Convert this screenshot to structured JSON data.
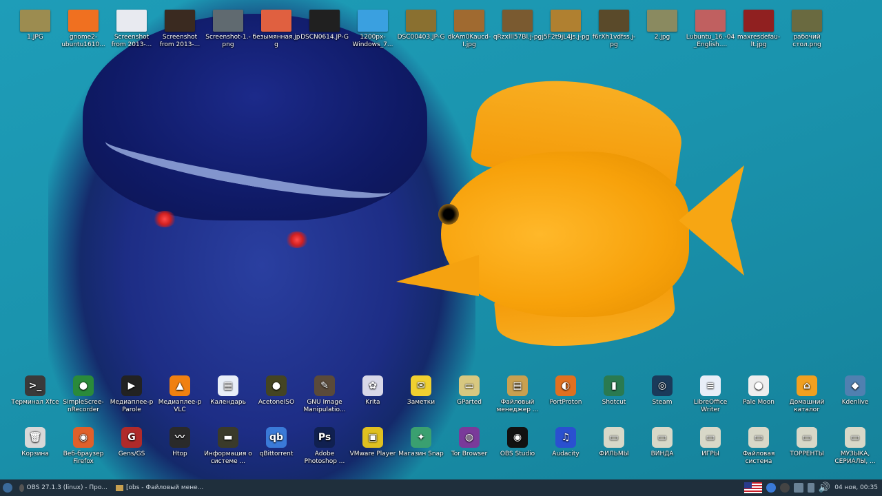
{
  "top_icons": [
    {
      "label": "1.JPG",
      "color": "#9c8c50"
    },
    {
      "label": "gnome2-ubuntu1610...",
      "color": "#f07020"
    },
    {
      "label": "Screenshot from 2013-...",
      "color": "#e8eaf0"
    },
    {
      "label": "Screenshot from 2013-...",
      "color": "#3a2a20"
    },
    {
      "label": "Screenshot-1.-png",
      "color": "#606a70"
    },
    {
      "label": "безымянная.jpg",
      "color": "#e06040"
    },
    {
      "label": "DSCN0614.JP-G",
      "color": "#202020"
    },
    {
      "label": "1200px-Windows_7...",
      "color": "#3aa0e0"
    },
    {
      "label": "DSC00403.JP-G",
      "color": "#8a7030"
    },
    {
      "label": "dkAm0Kaucd-I.jpg",
      "color": "#a06a30"
    },
    {
      "label": "qRzxIII57BI.j-pg",
      "color": "#7a5a30"
    },
    {
      "label": "j5F2t9jL4Js.j-pg",
      "color": "#b08030"
    },
    {
      "label": "f6rXh1vdfss.j-pg",
      "color": "#5a4a2a"
    },
    {
      "label": "2.jpg",
      "color": "#8a8a60"
    },
    {
      "label": "Lubuntu_16.-04_English....",
      "color": "#c06060"
    },
    {
      "label": "maxresdefau-lt.jpg",
      "color": "#902020"
    },
    {
      "label": "рабочий стол.png",
      "color": "#6a6a40"
    }
  ],
  "row1_icons": [
    {
      "label": "Терминал Xfce",
      "icon": "terminal-icon",
      "glyph": ">_",
      "color": "#3a3a3a"
    },
    {
      "label": "SimpleScree-nRecorder",
      "icon": "simplescreenrecorder-icon",
      "glyph": "●",
      "color": "#2a8a3a"
    },
    {
      "label": "Медиаплее-р Parole",
      "icon": "parole-icon",
      "glyph": "▶",
      "color": "#222"
    },
    {
      "label": "Медиаплее-р VLC",
      "icon": "vlc-icon",
      "glyph": "▲",
      "color": "#f08010"
    },
    {
      "label": "Календарь",
      "icon": "calendar-icon",
      "glyph": "▦",
      "color": "#e8eef8"
    },
    {
      "label": "AcetoneISO",
      "icon": "acetoneiso-icon",
      "glyph": "●",
      "color": "#442"
    },
    {
      "label": "GNU Image Manipulatio...",
      "icon": "gimp-icon",
      "glyph": "✎",
      "color": "#5a4a3a"
    },
    {
      "label": "Krita",
      "icon": "krita-icon",
      "glyph": "✿",
      "color": "#d8d8e8"
    },
    {
      "label": "Заметки",
      "icon": "notes-icon",
      "glyph": "✉",
      "color": "#f0d030"
    },
    {
      "label": "GParted",
      "icon": "gparted-icon",
      "glyph": "▭",
      "color": "#d8c880"
    },
    {
      "label": "Файловый менеджер ...",
      "icon": "file-manager-icon",
      "glyph": "▤",
      "color": "#c8a050"
    },
    {
      "label": "PortProton",
      "icon": "portproton-icon",
      "glyph": "◐",
      "color": "#e07020"
    },
    {
      "label": "Shotcut",
      "icon": "shotcut-icon",
      "glyph": "▮",
      "color": "#2a7a50"
    },
    {
      "label": "Steam",
      "icon": "steam-icon",
      "glyph": "◎",
      "color": "#1a3a5a"
    },
    {
      "label": "LibreOffice Writer",
      "icon": "libreoffice-writer-icon",
      "glyph": "≡",
      "color": "#e8eef8"
    },
    {
      "label": "Pale Moon",
      "icon": "palemoon-icon",
      "glyph": "●",
      "color": "#eeeeee"
    },
    {
      "label": "Домашний каталог",
      "icon": "home-folder-icon",
      "glyph": "⌂",
      "color": "#f0a020"
    },
    {
      "label": "Kdenlive",
      "icon": "kdenlive-icon",
      "glyph": "◆",
      "color": "#5080b0"
    }
  ],
  "row2_icons": [
    {
      "label": "Корзина",
      "icon": "trash-icon",
      "glyph": "🗑",
      "color": "#d8d8d8"
    },
    {
      "label": "Веб-браузер Firefox",
      "icon": "firefox-icon",
      "glyph": "◉",
      "color": "#e0602a"
    },
    {
      "label": "Gens/GS",
      "icon": "gens-icon",
      "glyph": "G",
      "color": "#b02a2a"
    },
    {
      "label": "Htop",
      "icon": "htop-icon",
      "glyph": "〰",
      "color": "#2a2a2a"
    },
    {
      "label": "Информация о системе ...",
      "icon": "system-info-icon",
      "glyph": "▬",
      "color": "#3a3a2a"
    },
    {
      "label": "qBittorrent",
      "icon": "qbittorrent-icon",
      "glyph": "qb",
      "color": "#3a7ad8"
    },
    {
      "label": "Adobe Photoshop ...",
      "icon": "photoshop-icon",
      "glyph": "Ps",
      "color": "#102050"
    },
    {
      "label": "VMware Player",
      "icon": "vmware-icon",
      "glyph": "▣",
      "color": "#e0c020"
    },
    {
      "label": "Магазин Snap",
      "icon": "snap-store-icon",
      "glyph": "✦",
      "color": "#3aa070"
    },
    {
      "label": "Tor Browser",
      "icon": "tor-icon",
      "glyph": "◍",
      "color": "#7a3a9a"
    },
    {
      "label": "OBS Studio",
      "icon": "obs-icon",
      "glyph": "◉",
      "color": "#111"
    },
    {
      "label": "Audacity",
      "icon": "audacity-icon",
      "glyph": "♫",
      "color": "#2a50d0"
    },
    {
      "label": "ФИЛЬМЫ",
      "icon": "drive-icon",
      "glyph": "▭",
      "color": "#d8d8c8"
    },
    {
      "label": "ВИНДА",
      "icon": "drive-icon",
      "glyph": "▭",
      "color": "#d8d8c8"
    },
    {
      "label": "ИГРЫ",
      "icon": "drive-icon",
      "glyph": "▭",
      "color": "#d8d8c8"
    },
    {
      "label": "Файловая система",
      "icon": "drive-icon",
      "glyph": "▭",
      "color": "#d8d8c8"
    },
    {
      "label": "ТОРРЕНТЫ",
      "icon": "drive-icon",
      "glyph": "▭",
      "color": "#d8d8c8"
    },
    {
      "label": "МУЗЫКА, СЕРИАЛЫ, ...",
      "icon": "drive-icon",
      "glyph": "▭",
      "color": "#d8d8c8"
    }
  ],
  "taskbar": {
    "task1": "OBS 27.1.3 (linux) - Про...",
    "task2": "[obs - Файловый мене...",
    "clock": "04 ноя, 00:35"
  }
}
